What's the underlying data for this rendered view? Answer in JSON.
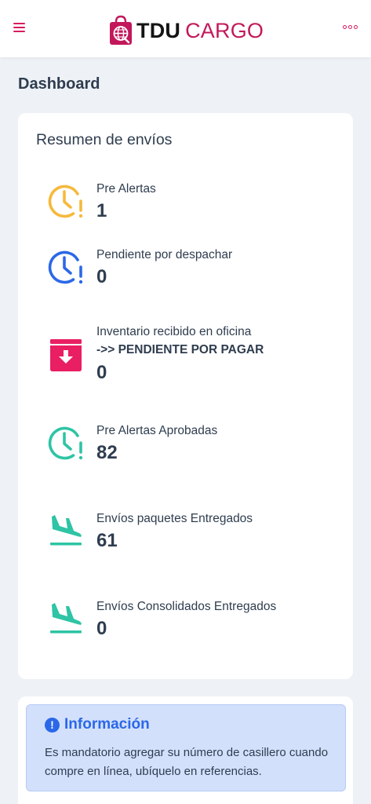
{
  "header": {
    "brand_bold": "TDU",
    "brand_light": "CARGO"
  },
  "page": {
    "title": "Dashboard"
  },
  "summary": {
    "title": "Resumen de envíos",
    "items": [
      {
        "label": "Pre Alertas",
        "value": "1",
        "icon": "clock-alert-icon",
        "color": "#f6b93b"
      },
      {
        "label": "Pendiente por despachar",
        "value": "0",
        "icon": "clock-alert-icon",
        "color": "#2b68e8"
      },
      {
        "label": "Inventario recibido en oficina",
        "sublabel": "->> PENDIENTE POR PAGAR",
        "value": "0",
        "icon": "inbox-download-icon",
        "color": "#e91e63"
      },
      {
        "label": "Pre Alertas Aprobadas",
        "value": "82",
        "icon": "clock-alert-icon",
        "color": "#2ec4a5"
      },
      {
        "label": "Envíos paquetes Entregados",
        "value": "61",
        "icon": "plane-landing-icon",
        "color": "#2ec4a5"
      },
      {
        "label": "Envíos Consolidados Entregados",
        "value": "0",
        "icon": "plane-landing-icon",
        "color": "#2ec4a5"
      }
    ]
  },
  "info": {
    "title": "Información",
    "text": "Es mandatorio agregar su número de casillero cuando compre en línea, ubíquelo en referencias."
  },
  "colors": {
    "brand": "#c2185b",
    "accent": "#d81b60",
    "info": "#2b68e8"
  }
}
